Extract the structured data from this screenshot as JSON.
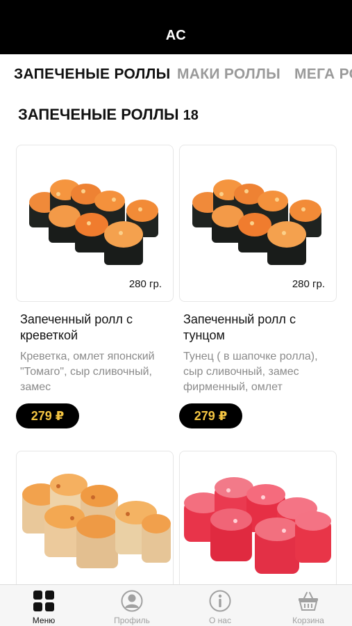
{
  "app": {
    "title": "АС"
  },
  "tabs": [
    {
      "label": "ЗАПЕЧЕНЫЕ РОЛЛЫ",
      "active": true
    },
    {
      "label": "МАКИ РОЛЛЫ",
      "active": false
    },
    {
      "label": "МЕГА РОЛЛЫ",
      "active": false
    }
  ],
  "section": {
    "title": "ЗАПЕЧЕНЫЕ РОЛЛЫ",
    "count": "18"
  },
  "products": [
    {
      "weight": "280 гр.",
      "name": "Запеченный ролл с креветкой",
      "description": "Креветка, омлет японский \"Томаго\", сыр сливочный, замес",
      "price": "279 ₽",
      "image": "baked-roll-orange"
    },
    {
      "weight": "280 гр.",
      "name": "Запеченный ролл с тунцом",
      "description": "Тунец ( в шапочке ролла), сыр сливочный, замес фирменный, омлет",
      "price": "279 ₽",
      "image": "baked-roll-orange"
    },
    {
      "image": "baked-roll-cream"
    },
    {
      "image": "baked-roll-red"
    }
  ],
  "bottom_nav": [
    {
      "label": "Меню",
      "icon": "menu-grid-icon",
      "active": true
    },
    {
      "label": "Профиль",
      "icon": "profile-icon",
      "active": false
    },
    {
      "label": "О нас",
      "icon": "info-icon",
      "active": false
    },
    {
      "label": "Корзина",
      "icon": "basket-icon",
      "active": false
    }
  ],
  "colors": {
    "top_bar": "#000000",
    "price_text": "#f4c542",
    "price_bg": "#000000",
    "muted": "#9a9a9a"
  }
}
